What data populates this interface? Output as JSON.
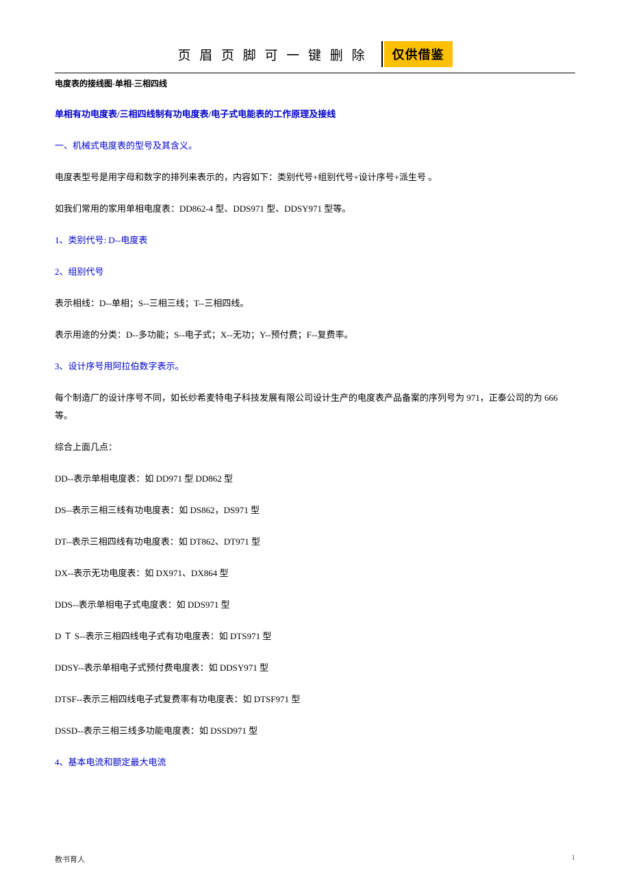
{
  "header": {
    "title": "页 眉 页 脚 可 一 键 删 除",
    "badge": "仅供借鉴"
  },
  "docName": "电度表的接线图-单相-三相四线",
  "content": {
    "mainTitle": "单相有功电度表/三相四线制有功电度表/电子式电能表的工作原理及接线",
    "p1": "一、机械式电度表的型号及其含义。",
    "p2": "电度表型号是用字母和数字的排列来表示的，内容如下：类别代号+组别代号+设计序号+派生号 。",
    "p3": "如我们常用的家用单相电度表：DD862-4 型、DDS971 型、DDSY971 型等。",
    "p4": "1、类别代号: D--电度表",
    "p5": "2、组别代号",
    "p6": "表示相线：D--单相；S--三相三线；T--三相四线。",
    "p7": "表示用途的分类：D--多功能；S--电子式；X--无功；Y--预付费；F--复费率。",
    "p8": "3、设计序号用阿拉伯数字表示。",
    "p9": "每个制造厂的设计序号不同，如长纱希麦特电子科技发展有限公司设计生产的电度表产品备案的序列号为 971，正泰公司的为 666 等。",
    "p10": "综合上面几点：",
    "p11": "DD--表示单相电度表：如 DD971 型 DD862 型",
    "p12": "DS--表示三相三线有功电度表：如 DS862，DS971 型",
    "p13": "DT--表示三相四线有功电度表：如 DT862、DT971 型",
    "p14": "DX--表示无功电度表：如 DX971、DX864 型",
    "p15": "DDS--表示单相电子式电度表：如 DDS971 型",
    "p16": "D Ｔ S--表示三相四线电子式有功电度表：如 DTS971 型",
    "p17": "DDSY--表示单相电子式预付费电度表：如 DDSY971 型",
    "p18": "DTSF--表示三相四线电子式复费率有功电度表：如 DTSF971 型",
    "p19": "DSSD--表示三相三线多功能电度表：如 DSSD971 型",
    "p20": "4、基本电流和额定最大电流"
  },
  "footer": {
    "left": "教书育人",
    "pageNum": "1"
  }
}
